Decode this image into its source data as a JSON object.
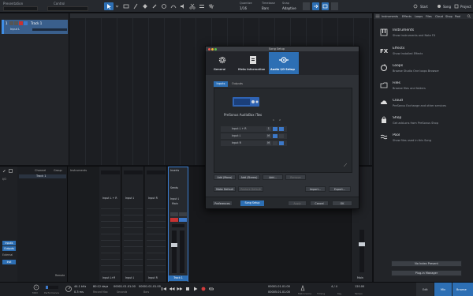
{
  "toolbar": {
    "presentation_label": "Presentation",
    "control_label": "Control",
    "quantize": {
      "label": "Quantize",
      "value": "1/16"
    },
    "timebase": {
      "label": "Timebase",
      "value": "Bars"
    },
    "snap": {
      "label": "Snap",
      "value": "Adaptive"
    },
    "nav": {
      "start": "Start",
      "song": "Song",
      "project": "Project"
    }
  },
  "track": {
    "name": "Track 1",
    "input": "Input L"
  },
  "browser": {
    "tabs": [
      "Instruments",
      "Effects",
      "Loops",
      "Files",
      "Cloud",
      "Shop",
      "Pool"
    ],
    "items": [
      {
        "icon": "piano-keys-icon",
        "title": "Instruments",
        "desc": "Show Instruments and Note FX"
      },
      {
        "icon": "fx-icon",
        "title": "Effects",
        "desc": "Show Installed Effects"
      },
      {
        "icon": "loop-icon",
        "title": "Loops",
        "desc": "Browse Studio One loops Browser"
      },
      {
        "icon": "folder-icon",
        "title": "Files",
        "desc": "Browse files and folders"
      },
      {
        "icon": "cloud-icon",
        "title": "Cloud",
        "desc": "PreSonus Exchange and other services"
      },
      {
        "icon": "shop-bag-icon",
        "title": "Shop",
        "desc": "Get add-ons from PreSonus Shop"
      },
      {
        "icon": "pool-icon",
        "title": "Pool",
        "desc": "Show files used in this Song"
      }
    ],
    "no_index": "No Index Present",
    "plugin_manager": "Plug-in Manager"
  },
  "dialog": {
    "title": "Song Setup",
    "tabs": [
      "General",
      "Meta Information",
      "Audio I/O Setup"
    ],
    "subtabs": [
      "Inputs",
      "Outputs"
    ],
    "device_name": "PreSonus AudioBox iTwo",
    "channels": [
      "1",
      "2"
    ],
    "rows": [
      {
        "name": "Input L + R",
        "mode": "S"
      },
      {
        "name": "Input L",
        "mode": "M"
      },
      {
        "name": "Input R",
        "mode": "M"
      }
    ],
    "add_buttons": [
      "Add (Mono)",
      "Add (Stereo)",
      "Add...",
      "Remove"
    ],
    "default_buttons": [
      "Make Default",
      "Restore Default",
      "Import...",
      "Export..."
    ],
    "footer": {
      "preferences": "Preferences",
      "song_setup": "Song Setup",
      "apply": "Apply",
      "cancel": "Cancel",
      "ok": "OK"
    }
  },
  "mixer": {
    "tabs": [
      "Channel",
      "Group"
    ],
    "instruments": "Instruments",
    "track_item": "Track 1",
    "remote": "Remote",
    "left_buttons": [
      "Inputs",
      "Outputs",
      "External",
      "Inst"
    ],
    "strips": [
      {
        "input": "Input L + R",
        "name": "Input L+R"
      },
      {
        "input": "Input L",
        "name": "Input L"
      },
      {
        "input": "Input R",
        "name": "Input R"
      }
    ],
    "main_strip": {
      "insert": "Inserts",
      "sends": "Sends",
      "input": "Input L",
      "output": "Main",
      "name": "Track 1"
    },
    "right_strip": {
      "label": "Main"
    }
  },
  "transport": {
    "midi_label": "MIDI",
    "perf_label": "Performance",
    "sample_rate": "44.1 kHz",
    "latency": "0.3 ms",
    "record_time": "80:12 days",
    "record_label": "Record Max",
    "seconds_label": "Seconds",
    "bars_label": "Bars",
    "position": "00001.01.01.00",
    "position2": "00001.01.01.00",
    "loop_start": "00001.01.01.00",
    "loop_end": "00005.01.01.00",
    "signature": "4 / 4",
    "tempo": "120.00",
    "metronome_label": "Metronome",
    "timing_label": "Timing",
    "key_label": "Key",
    "tempo_label": "Tempo",
    "edit": "Edit",
    "mix": "Mix",
    "browse": "Browse"
  }
}
